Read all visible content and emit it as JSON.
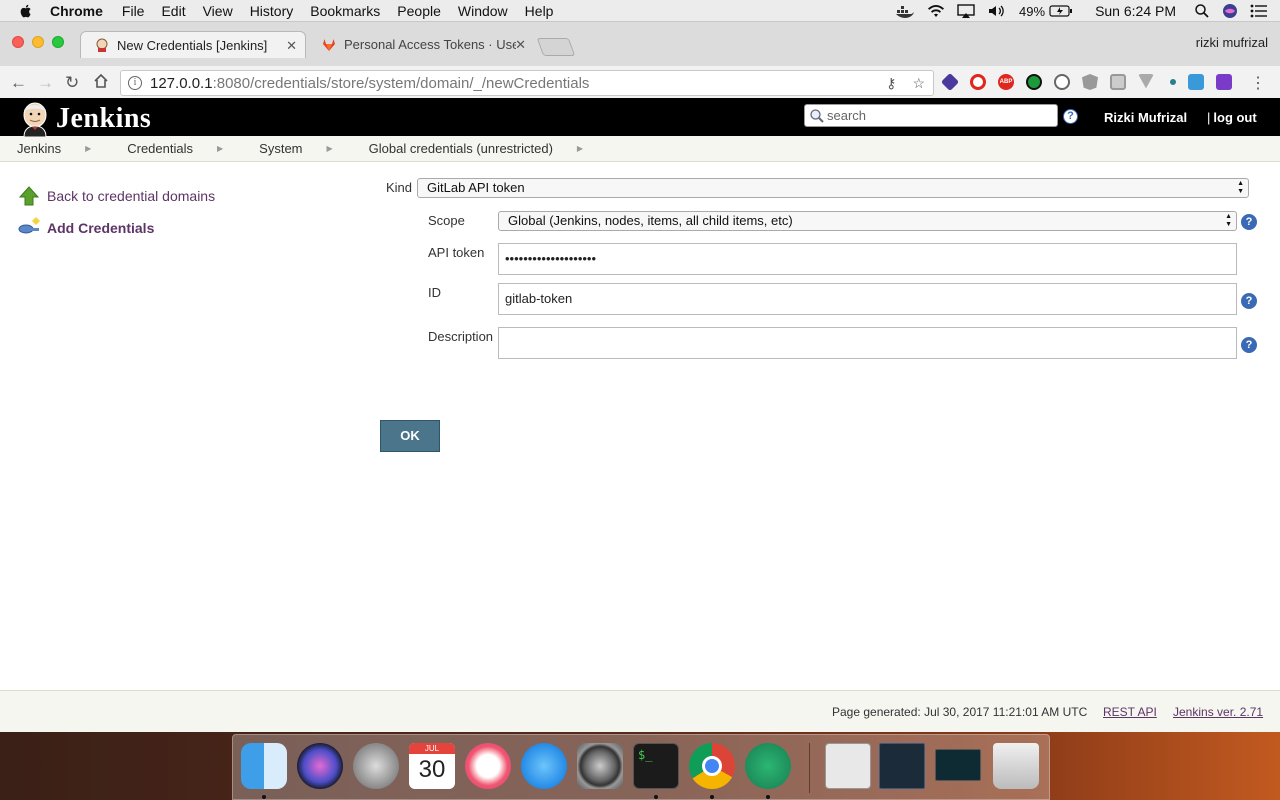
{
  "menubar": {
    "app": "Chrome",
    "items": [
      "File",
      "Edit",
      "View",
      "History",
      "Bookmarks",
      "People",
      "Window",
      "Help"
    ],
    "battery": "49%",
    "clock": "Sun 6:24 PM"
  },
  "browser": {
    "tabs": [
      {
        "title": "New Credentials [Jenkins]",
        "active": true
      },
      {
        "title": "Personal Access Tokens · User",
        "active": false
      }
    ],
    "profile": "rizki mufrizal",
    "url_host": "127.0.0.1",
    "url_rest": ":8080/credentials/store/system/domain/_/newCredentials"
  },
  "jenkins": {
    "brand": "Jenkins",
    "search_placeholder": "search",
    "user": "Rizki Mufrizal",
    "logout": "log out",
    "breadcrumbs": [
      "Jenkins",
      "Credentials",
      "System",
      "Global credentials (unrestricted)"
    ],
    "sidebar": [
      {
        "label": "Back to credential domains",
        "icon": "up-arrow-icon"
      },
      {
        "label": "Add Credentials",
        "icon": "key-icon"
      }
    ],
    "form": {
      "kind_label": "Kind",
      "kind_value": "GitLab API token",
      "scope_label": "Scope",
      "scope_value": "Global (Jenkins, nodes, items, all child items, etc)",
      "api_token_label": "API token",
      "api_token_value": "••••••••••••••••••••",
      "id_label": "ID",
      "id_value": "gitlab-token",
      "description_label": "Description",
      "description_value": "",
      "ok_label": "OK"
    },
    "footer": {
      "generated": "Page generated: Jul 30, 2017 11:21:01 AM UTC",
      "rest_api": "REST API",
      "version": "Jenkins ver. 2.71"
    }
  },
  "dock": {
    "calendar_month": "JUL",
    "calendar_day": "30",
    "apps": [
      "finder-icon",
      "siri-icon",
      "launchpad-icon",
      "calendar-icon",
      "itunes-icon",
      "app-store-icon",
      "system-preferences-icon",
      "terminal-icon",
      "chrome-icon",
      "atom-icon",
      "downloads-icon",
      "screenshot-icon",
      "screenshot-icon",
      "trash-icon"
    ]
  }
}
